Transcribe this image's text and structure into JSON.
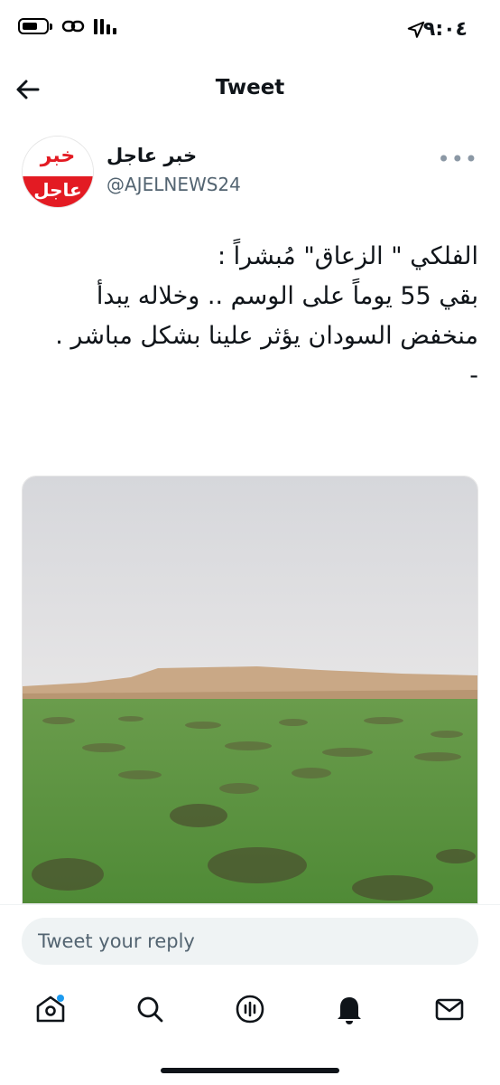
{
  "status_bar": {
    "time": "٩:٠٤"
  },
  "header": {
    "title": "Tweet"
  },
  "author": {
    "display_name": "خبر عاجل",
    "handle": "@AJELNEWS24",
    "avatar_top_text": "خبر",
    "avatar_bottom_text": "عاجل"
  },
  "tweet": {
    "line1": "الفلكي \" الزعاق\" مُبشراً :",
    "line2": "بقي 55 يوماً على الوسم .. وخلاله يبدأ منخفض السودان يؤثر علينا بشكل مباشر .",
    "line3": "-"
  },
  "media": {
    "description": "desert-grass-landscape",
    "colors": {
      "sky": "#dcdde0",
      "sand": "#c6a583",
      "grass": "#5a8f3e"
    }
  },
  "reply": {
    "placeholder": "Tweet your reply"
  },
  "tabs": [
    {
      "icon": "home-icon"
    },
    {
      "icon": "search-icon"
    },
    {
      "icon": "spaces-icon"
    },
    {
      "icon": "notifications-icon"
    },
    {
      "icon": "messages-icon"
    }
  ],
  "colors": {
    "text": "#0f1419",
    "secondary": "#536471",
    "accent": "#1d9bf0",
    "brand_red": "#e31b23"
  }
}
